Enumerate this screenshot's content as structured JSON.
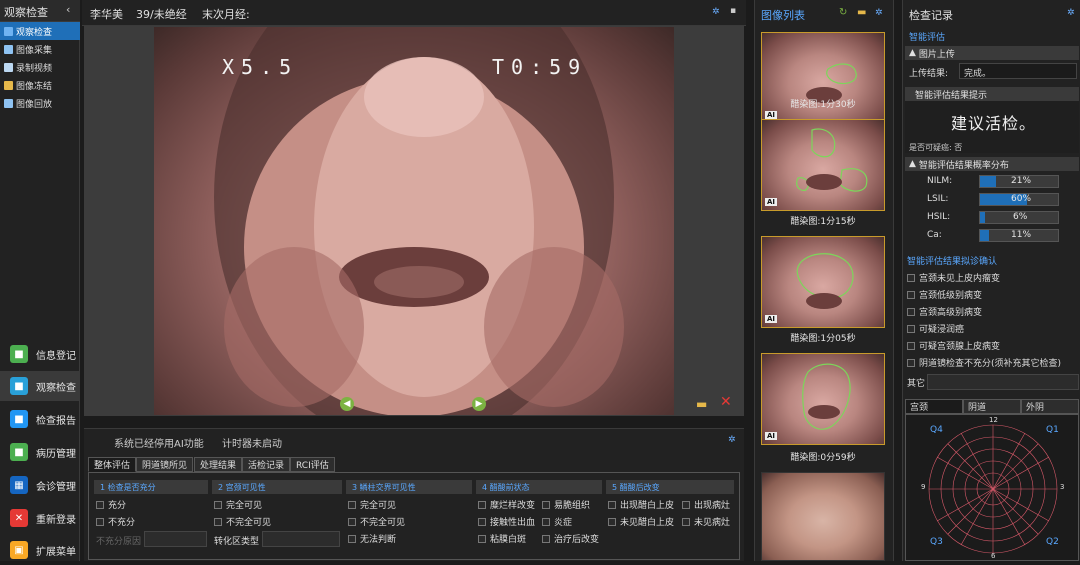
{
  "sidebar": {
    "title": "观察检查",
    "items": [
      {
        "label": "观察检查",
        "icon": "eye-icon"
      },
      {
        "label": "图像采集",
        "icon": "camera-icon"
      },
      {
        "label": "录制视频",
        "icon": "video-icon"
      },
      {
        "label": "图像冻结",
        "icon": "freeze-icon"
      },
      {
        "label": "图像回放",
        "icon": "replay-icon"
      }
    ],
    "bottom_buttons": [
      {
        "label": "信息登记",
        "icon": "info-register-icon",
        "color": "#4caf50"
      },
      {
        "label": "观察检查",
        "icon": "observe-icon",
        "color": "#29a0d8"
      },
      {
        "label": "检查报告",
        "icon": "report-icon",
        "color": "#2196f3"
      },
      {
        "label": "病历管理",
        "icon": "records-icon",
        "color": "#4caf50"
      },
      {
        "label": "会诊管理",
        "icon": "consult-icon",
        "color": "#1565c0"
      },
      {
        "label": "重新登录",
        "icon": "relogin-icon",
        "color": "#e53935"
      },
      {
        "label": "扩展菜单",
        "icon": "lock-icon",
        "color": "#f9a825"
      }
    ]
  },
  "topbar": {
    "patient": "李华美",
    "age": "39/未绝经",
    "last_period": "末次月经:"
  },
  "viewer": {
    "zoom": "X5.5",
    "time": "T0:59"
  },
  "bottom": {
    "status_ai": "系统已经停用AI功能",
    "status_timer": "计时器未启动",
    "tabs": [
      "整体评估",
      "阴道镜所见",
      "处理结果",
      "活检记录",
      "RCI评估"
    ],
    "columns": [
      {
        "head": "1 检查是否充分",
        "items": [
          "充分",
          "不充分"
        ],
        "reason_label": "不充分原因"
      },
      {
        "head": "2 宫颈可见性",
        "items": [
          "完全可见",
          "不完全可见"
        ],
        "zone_label": "转化区类型"
      },
      {
        "head": "3 鳞柱交界可见性",
        "items": [
          "完全可见",
          "不完全可见",
          "无法判断"
        ]
      },
      {
        "head": "4 醋酸前状态",
        "items": [
          "糜烂样改变",
          "易脆组织",
          "接触性出血",
          "炎症",
          "粘膜白斑",
          "治疗后改变"
        ]
      },
      {
        "head": "5 醋酸后改变",
        "items": [
          "出现醋白上皮",
          "出现病灶",
          "未见醋白上皮",
          "未见病灶"
        ]
      }
    ]
  },
  "imagelist": {
    "title": "图像列表",
    "ai_badge": "AI",
    "captions": [
      "醋染图:1分30秒",
      "醋染图:1分15秒",
      "醋染图:1分05秒",
      "醋染图:0分59秒"
    ]
  },
  "records": {
    "title": "检查记录",
    "smart_eval": "智能评估",
    "upload_head": "图片上传",
    "upload_label": "上传结果:",
    "upload_value": "完成。",
    "hint_head": "智能评估结果提示",
    "suggestion": "建议活检。",
    "suspicious": "是否可疑癌: 否",
    "prob_head": "智能评估结果概率分布",
    "probabilities": [
      {
        "label": "NILM:",
        "value": "21%",
        "fraction": 0.21
      },
      {
        "label": "LSIL:",
        "value": "60%",
        "fraction": 0.6
      },
      {
        "label": "HSIL:",
        "value": "6%",
        "fraction": 0.06
      },
      {
        "label": "Ca:",
        "value": "11%",
        "fraction": 0.11
      }
    ],
    "confirm_head": "智能评估结果拟诊确认",
    "confirm_items": [
      "宫颈未见上皮内瘤变",
      "宫颈低级别病变",
      "宫颈高级别病变",
      "可疑浸润癌",
      "可疑宫颈腺上皮病变",
      "阴道镜检查不充分(须补充其它检查)"
    ],
    "other_label": "其它",
    "tabs": [
      "宫颈",
      "阴道",
      "外阴"
    ],
    "clock": {
      "top": "12",
      "right": "3",
      "bottom": "6",
      "left": "9",
      "q1": "Q1",
      "q2": "Q2",
      "q3": "Q3",
      "q4": "Q4"
    }
  },
  "colors": {
    "accent": "#1f6fb8",
    "link_blue": "#5aa8ff",
    "thumb_border": "#c89b2b",
    "lesion_outline": "#7cd65a"
  }
}
